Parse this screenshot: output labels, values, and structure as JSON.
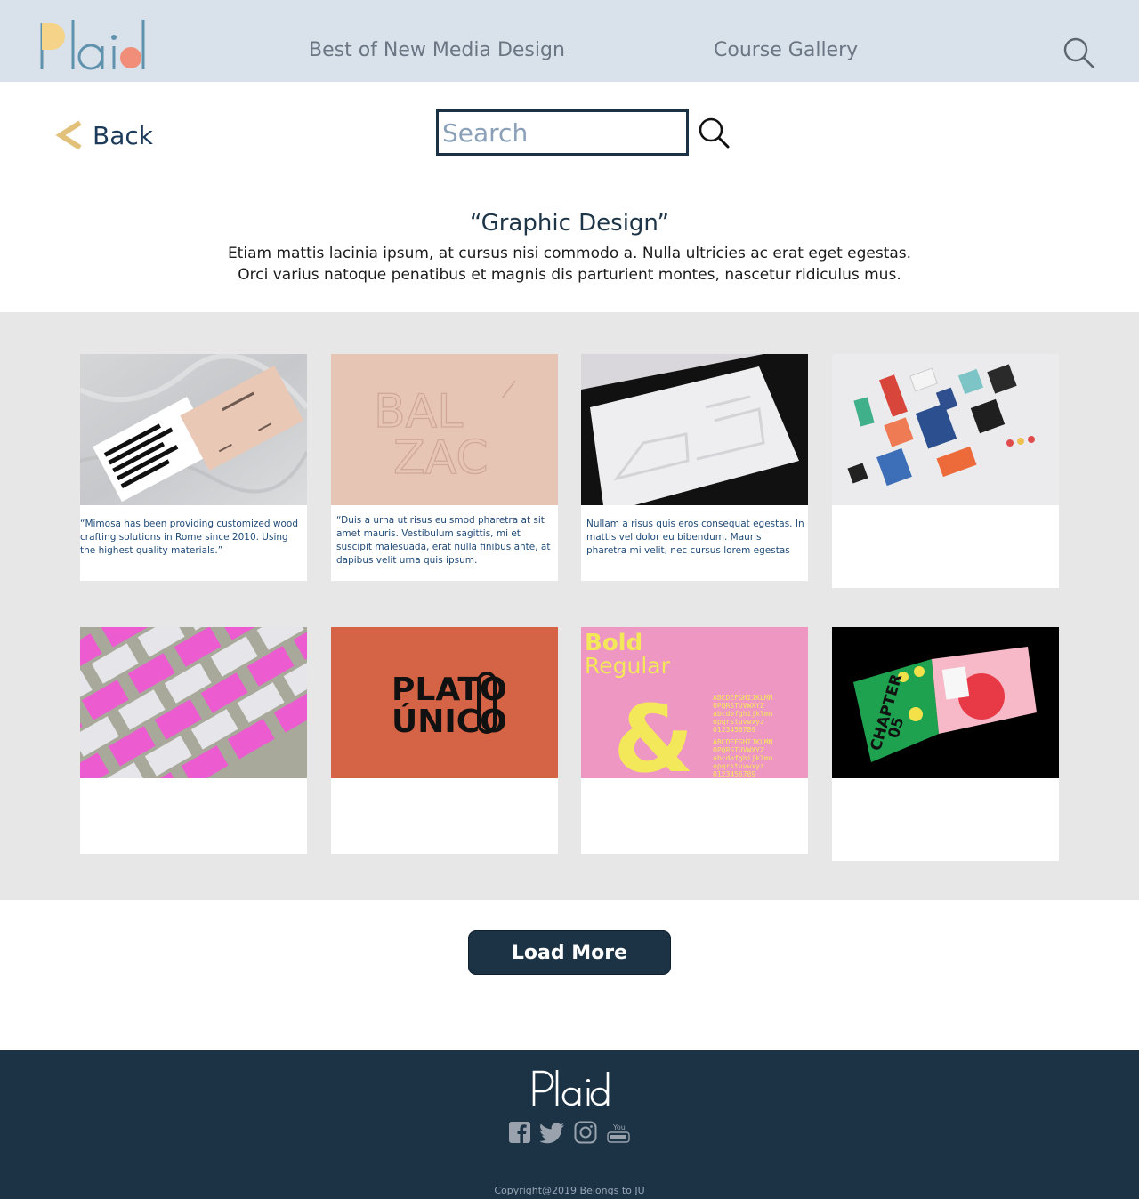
{
  "header": {
    "logo_text": "Plaid",
    "nav": [
      {
        "label": "Best of New Media Design"
      },
      {
        "label": "Course Gallery"
      }
    ],
    "search_icon": "search-icon"
  },
  "toolbar": {
    "back_label": "Back",
    "search_placeholder": "Search"
  },
  "intro": {
    "title": "“Graphic Design”",
    "description_line1": "Etiam mattis lacinia ipsum, at cursus nisi commodo a. Nulla ultricies ac erat eget egestas.",
    "description_line2": "Orci varius natoque penatibus et magnis dis parturient montes, nascetur ridiculus mus."
  },
  "gallery": {
    "cards": [
      {
        "caption": "“Mimosa has been providing customized wood crafting solutions in Rome since 2010. Using the highest quality materials.”",
        "image": "business cards on marble"
      },
      {
        "caption": "“Duis a urna ut risus euismod pharetra at sit amet mauris. Vestibulum sagittis, mi et suscipit malesuada, erat nulla finibus ante, at dapibus velit urna quis ipsum.",
        "image": "BALZAC embossed pink paper",
        "image_text": [
          "BAL",
          "ZAC"
        ]
      },
      {
        "caption": " Nullam a risus quis eros consequat egestas. In mattis vel dolor eu bibendum. Mauris pharetra mi velit, nec cursus lorem egestas",
        "image": "embossed white card in black frame"
      },
      {
        "caption": "",
        "image": "product packaging flat lay"
      },
      {
        "caption": "",
        "image": "pink patterned business cards"
      },
      {
        "caption": "",
        "image": "PLATO UNICO logo on orange",
        "image_text": [
          "PLATO",
          "ÚNICO"
        ]
      },
      {
        "caption": "",
        "image": "Bold Regular type specimen",
        "image_text": [
          "Bold",
          "Regular",
          "&",
          "ABCDEFGHIJKLMN",
          "OPQRSTUVWXYZ",
          "abcdefghijklmn",
          "opqrstuvwxyz",
          "0123456789"
        ]
      },
      {
        "caption": "",
        "image": "CHAPTER 05 open book on black",
        "image_text": [
          "CHAPTER",
          "05"
        ]
      }
    ]
  },
  "actions": {
    "load_more": "Load More"
  },
  "footer": {
    "logo_text": "Plaid",
    "social": [
      "facebook-icon",
      "twitter-icon",
      "instagram-icon",
      "youtube-icon"
    ],
    "youtube_text": "You Tube",
    "copyright": "Copyright@2019 Belongs to JU"
  },
  "colors": {
    "header_bg": "#d9e1ea",
    "primary_dark": "#1c3346",
    "gallery_bg": "#e7e7e7",
    "back_arrow": "#e2c17a",
    "logo_blue": "#5f93ad",
    "logo_yellow": "#f5d389",
    "logo_coral": "#f08e79"
  }
}
